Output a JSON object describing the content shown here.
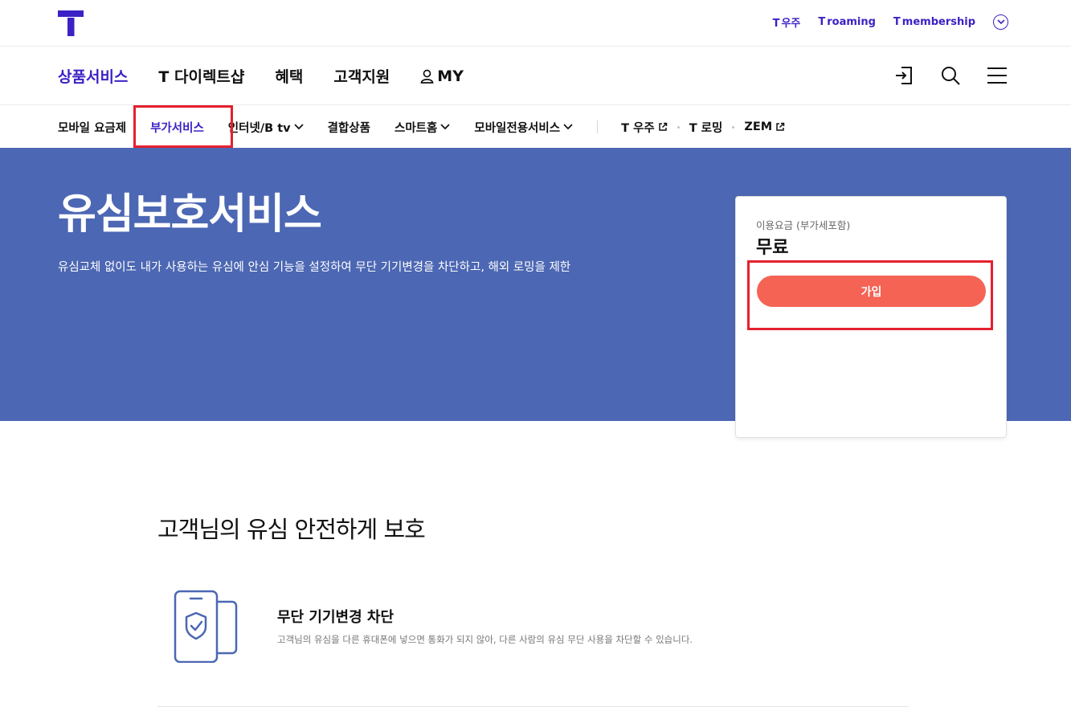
{
  "colors": {
    "brand": "#3b22c4",
    "hero_bg": "#4c67b3",
    "join_button": "#f56354",
    "highlight": "#e5202e"
  },
  "header": {
    "logo_icon": "t-logo-icon",
    "util_links": [
      {
        "prefix": "T",
        "label": "우주"
      },
      {
        "prefix": "T",
        "label": "roaming"
      },
      {
        "prefix": "T",
        "label": "membership"
      }
    ],
    "util_more_icon": "chevron-circle-down-icon"
  },
  "gnb": {
    "items": [
      {
        "label": "상품서비스"
      },
      {
        "label": "T 다이렉트샵"
      },
      {
        "label": "혜택"
      },
      {
        "label": "고객지원"
      },
      {
        "label": "MY"
      }
    ],
    "tools": [
      "login-icon",
      "search-icon",
      "menu-icon"
    ]
  },
  "lnb": {
    "items": [
      {
        "label": "모바일 요금제"
      },
      {
        "label": "부가서비스"
      },
      {
        "label": "인터넷/B tv"
      },
      {
        "label": "결합상품"
      },
      {
        "label": "스마트홈"
      },
      {
        "label": "모바일전용서비스"
      }
    ],
    "external": [
      {
        "label": "T 우주"
      },
      {
        "label": "T 로밍"
      },
      {
        "label": "ZEM"
      }
    ]
  },
  "hero": {
    "title": "유심보호서비스",
    "description": "유심교체 없이도 내가 사용하는 유심에 안심 기능을 설정하여 무단 기기변경을 차단하고, 해외 로밍을 제한"
  },
  "price_card": {
    "label": "이용요금 (부가세포함)",
    "value": "무료",
    "join_label": "가입"
  },
  "content": {
    "section_title": "고객님의 유심 안전하게 보호",
    "features": [
      {
        "icon": "phone-shield-icon",
        "title": "무단 기기변경 차단",
        "description": "고객님의 유심을 다른 휴대폰에 넣으면 통화가 되지 않아, 다른 사람의 유심 무단 사용을 차단할 수 있습니다."
      }
    ]
  }
}
